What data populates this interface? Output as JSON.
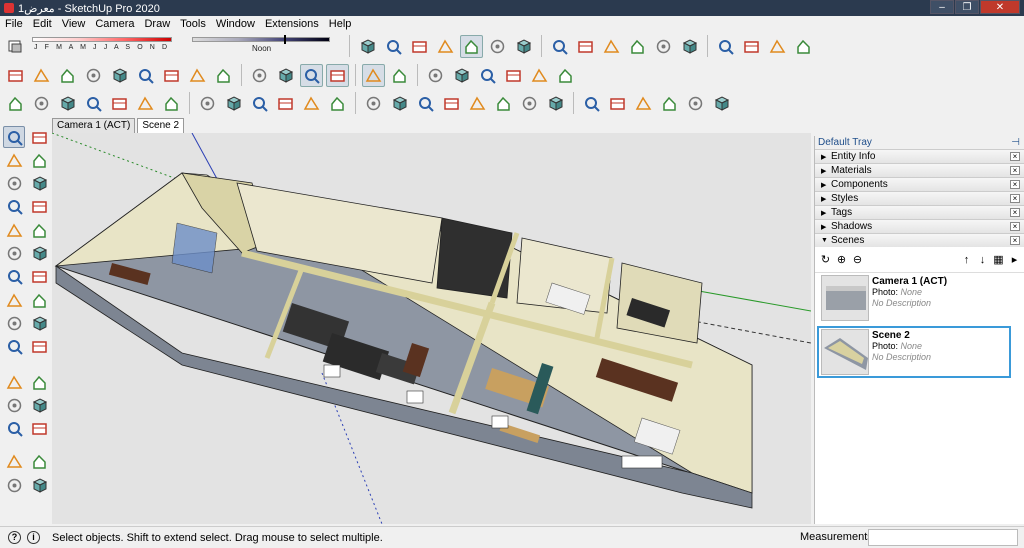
{
  "window": {
    "title": "معرض1 - SketchUp Pro 2020",
    "minimize": "–",
    "maximize": "❐",
    "close": "✕"
  },
  "menu": [
    "File",
    "Edit",
    "View",
    "Camera",
    "Draw",
    "Tools",
    "Window",
    "Extensions",
    "Help"
  ],
  "shadow_settings": {
    "months_label": "J F M A M J J A S O N D",
    "time_label": "Noon"
  },
  "tabs": [
    {
      "label": "Camera 1 (ACT)",
      "active": false
    },
    {
      "label": "Scene 2",
      "active": true
    }
  ],
  "toolbar_icons": {
    "row1": [
      "shadow-settings-icon",
      "iso-view-icon",
      "top-view-icon",
      "front-view-icon",
      "right-view-icon",
      "back-view-icon",
      "left-view-icon",
      "bottom-view-icon",
      "warehouse-icon",
      "share-model-icon",
      "house-icon",
      "component-house-icon",
      "house-outline-icon",
      "layer-house-icon",
      "extension-warehouse-icon",
      "extension-manager-icon",
      "gem-icon",
      "ruby-icon"
    ],
    "row2": [
      "orbit-icon",
      "pan-icon",
      "zoom-icon",
      "zoom-window-icon",
      "zoom-extents-icon",
      "previous-view-icon",
      "position-camera-icon",
      "look-around-icon",
      "walk-icon",
      "section-plane-icon",
      "display-section-planes-icon",
      "display-section-cuts-icon",
      "section-fill-icon",
      "xray-icon",
      "back-edges-icon",
      "wireframe-icon",
      "hidden-line-icon",
      "shaded-icon",
      "shaded-textures-icon",
      "monochrome-icon",
      "style-icon"
    ],
    "row3": [
      "sandbox-from-contours-icon",
      "sandbox-from-scratch-icon",
      "teapot-icon",
      "teapot-hand-icon",
      "stamp-icon",
      "drape-icon",
      "add-detail-icon",
      "flip-edge-icon",
      "smoove-icon",
      "lo-send-icon",
      "lo-view-icon",
      "dimension-icon",
      "lock-icon",
      "photo-match-icon",
      "section-tool-icon",
      "mirror-icon",
      "protractor-icon",
      "signpost-icon",
      "sun-icon",
      "dome-icon",
      "box-icon",
      "advanced-camera-icon",
      "advanced-box-icon",
      "advanced-cube-icon",
      "solid-union-icon",
      "solid-subtract-icon",
      "solid-trim-icon"
    ]
  },
  "left_toolbar_icons": [
    "select-arrow-icon",
    "make-component-icon",
    "paint-bucket-icon",
    "eraser-icon",
    "pencil-line-icon",
    "freehand-icon",
    "rectangle-icon",
    "rotated-rectangle-icon",
    "circle-icon",
    "polygon-icon",
    "arc-icon",
    "two-point-arc-icon",
    "three-point-arc-icon",
    "pie-icon",
    "move-icon",
    "push-pull-icon",
    "rotate-icon",
    "follow-me-icon",
    "scale-icon",
    "offset-icon",
    "tape-measure-icon",
    "dimension-tool-icon",
    "protractor-tool-icon",
    "text-tool-icon",
    "axes-icon",
    "3d-text-icon",
    "orbit-tool-icon",
    "pan-tool-icon",
    "zoom-tool-icon",
    "zoom-window-tool-icon"
  ],
  "tray": {
    "title": "Default Tray",
    "pin": "⊣",
    "sections": [
      {
        "label": "Entity Info",
        "expanded": false
      },
      {
        "label": "Materials",
        "expanded": false
      },
      {
        "label": "Components",
        "expanded": false
      },
      {
        "label": "Styles",
        "expanded": false
      },
      {
        "label": "Tags",
        "expanded": false
      },
      {
        "label": "Shadows",
        "expanded": false
      },
      {
        "label": "Scenes",
        "expanded": true
      }
    ],
    "scenes": [
      {
        "name": "Camera 1 (ACT)",
        "photo_label": "Photo:",
        "photo_value": "None",
        "description": "No Description",
        "selected": false
      },
      {
        "name": "Scene 2",
        "photo_label": "Photo:",
        "photo_value": "None",
        "description": "No Description",
        "selected": true
      }
    ]
  },
  "status": {
    "message": "Select objects. Shift to extend select. Drag mouse to select multiple.",
    "measurements_label": "Measurements",
    "measurements_value": ""
  }
}
